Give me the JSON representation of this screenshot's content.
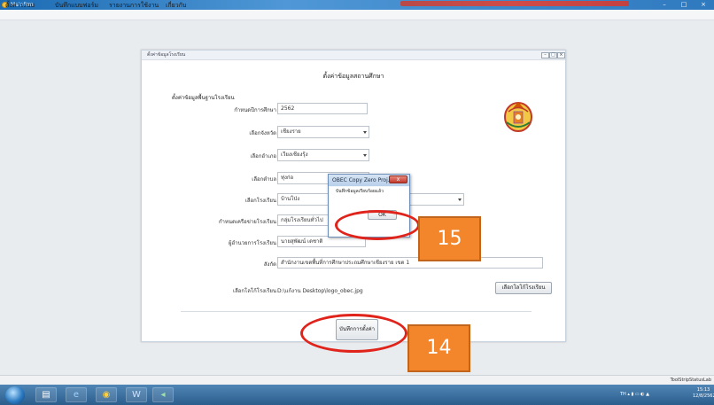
{
  "window": {
    "title": "MainFrm",
    "min_label": "–",
    "max_label": "□",
    "close_label": "×"
  },
  "menu": [
    "ตั้งค่าระบบ",
    "บันทึกแบบฟอร์ม",
    "รายงานการใช้งาน",
    "เกี่ยวกับ"
  ],
  "panel": {
    "title": "ตั้งค่าข้อมูลโรงเรียน",
    "header": "ตั้งค่าข้อมูลสถานศึกษา",
    "group_title": "ตั้งค่าข้อมูลพื้นฐานโรงเรียน",
    "fields": {
      "academic_year": {
        "label": "กำหนดปีการศึกษา",
        "value": "2562"
      },
      "province": {
        "label": "เลือกจังหวัด",
        "value": "เชียงราย"
      },
      "district": {
        "label": "เลือกอำเภอ",
        "value": "เวียงเชียงรุ้ง"
      },
      "subdistrict": {
        "label": "เลือกตำบล",
        "value": "ทุ่งก่อ"
      },
      "school": {
        "label": "เลือกโรงเรียน",
        "value": "บ้านโป่ง"
      },
      "network": {
        "label": "กำหนดเครือข่ายโรงเรียน",
        "value": "กลุ่มโรงเรียนทั่วไป"
      },
      "director": {
        "label": "ผู้อำนวยการโรงเรียน",
        "value": "นายสุพัฒน์  เดชาติ"
      },
      "affiliation": {
        "label": "สังกัด",
        "value": "สำนักงานเขตพื้นที่การศึกษาประถมศึกษาเชียงราย เขต 1"
      },
      "logo": {
        "label": "เลือกโลโก้โรงเรียน",
        "value": "D:\\แก้งาน Desktop\\logo_obec.jpg",
        "button": "เลือกโลโก้โรงเรียน"
      }
    },
    "save_button": "บันทึกการตั้งค่า"
  },
  "dialog": {
    "title": "OBEC Copy Zero Proj...",
    "message": "บันทึกข้อมูลเรียบร้อยแล้ว",
    "ok": "OK",
    "close": "x"
  },
  "annotations": {
    "step_ok": "15",
    "step_save": "14",
    "color": "#f3862a",
    "ring_color": "#e0241b"
  },
  "status": {
    "text": "ToolStripStatusLab"
  },
  "taskbar": {
    "tray_lang": "TH",
    "time": "15:13",
    "date": "12/8/2562"
  }
}
